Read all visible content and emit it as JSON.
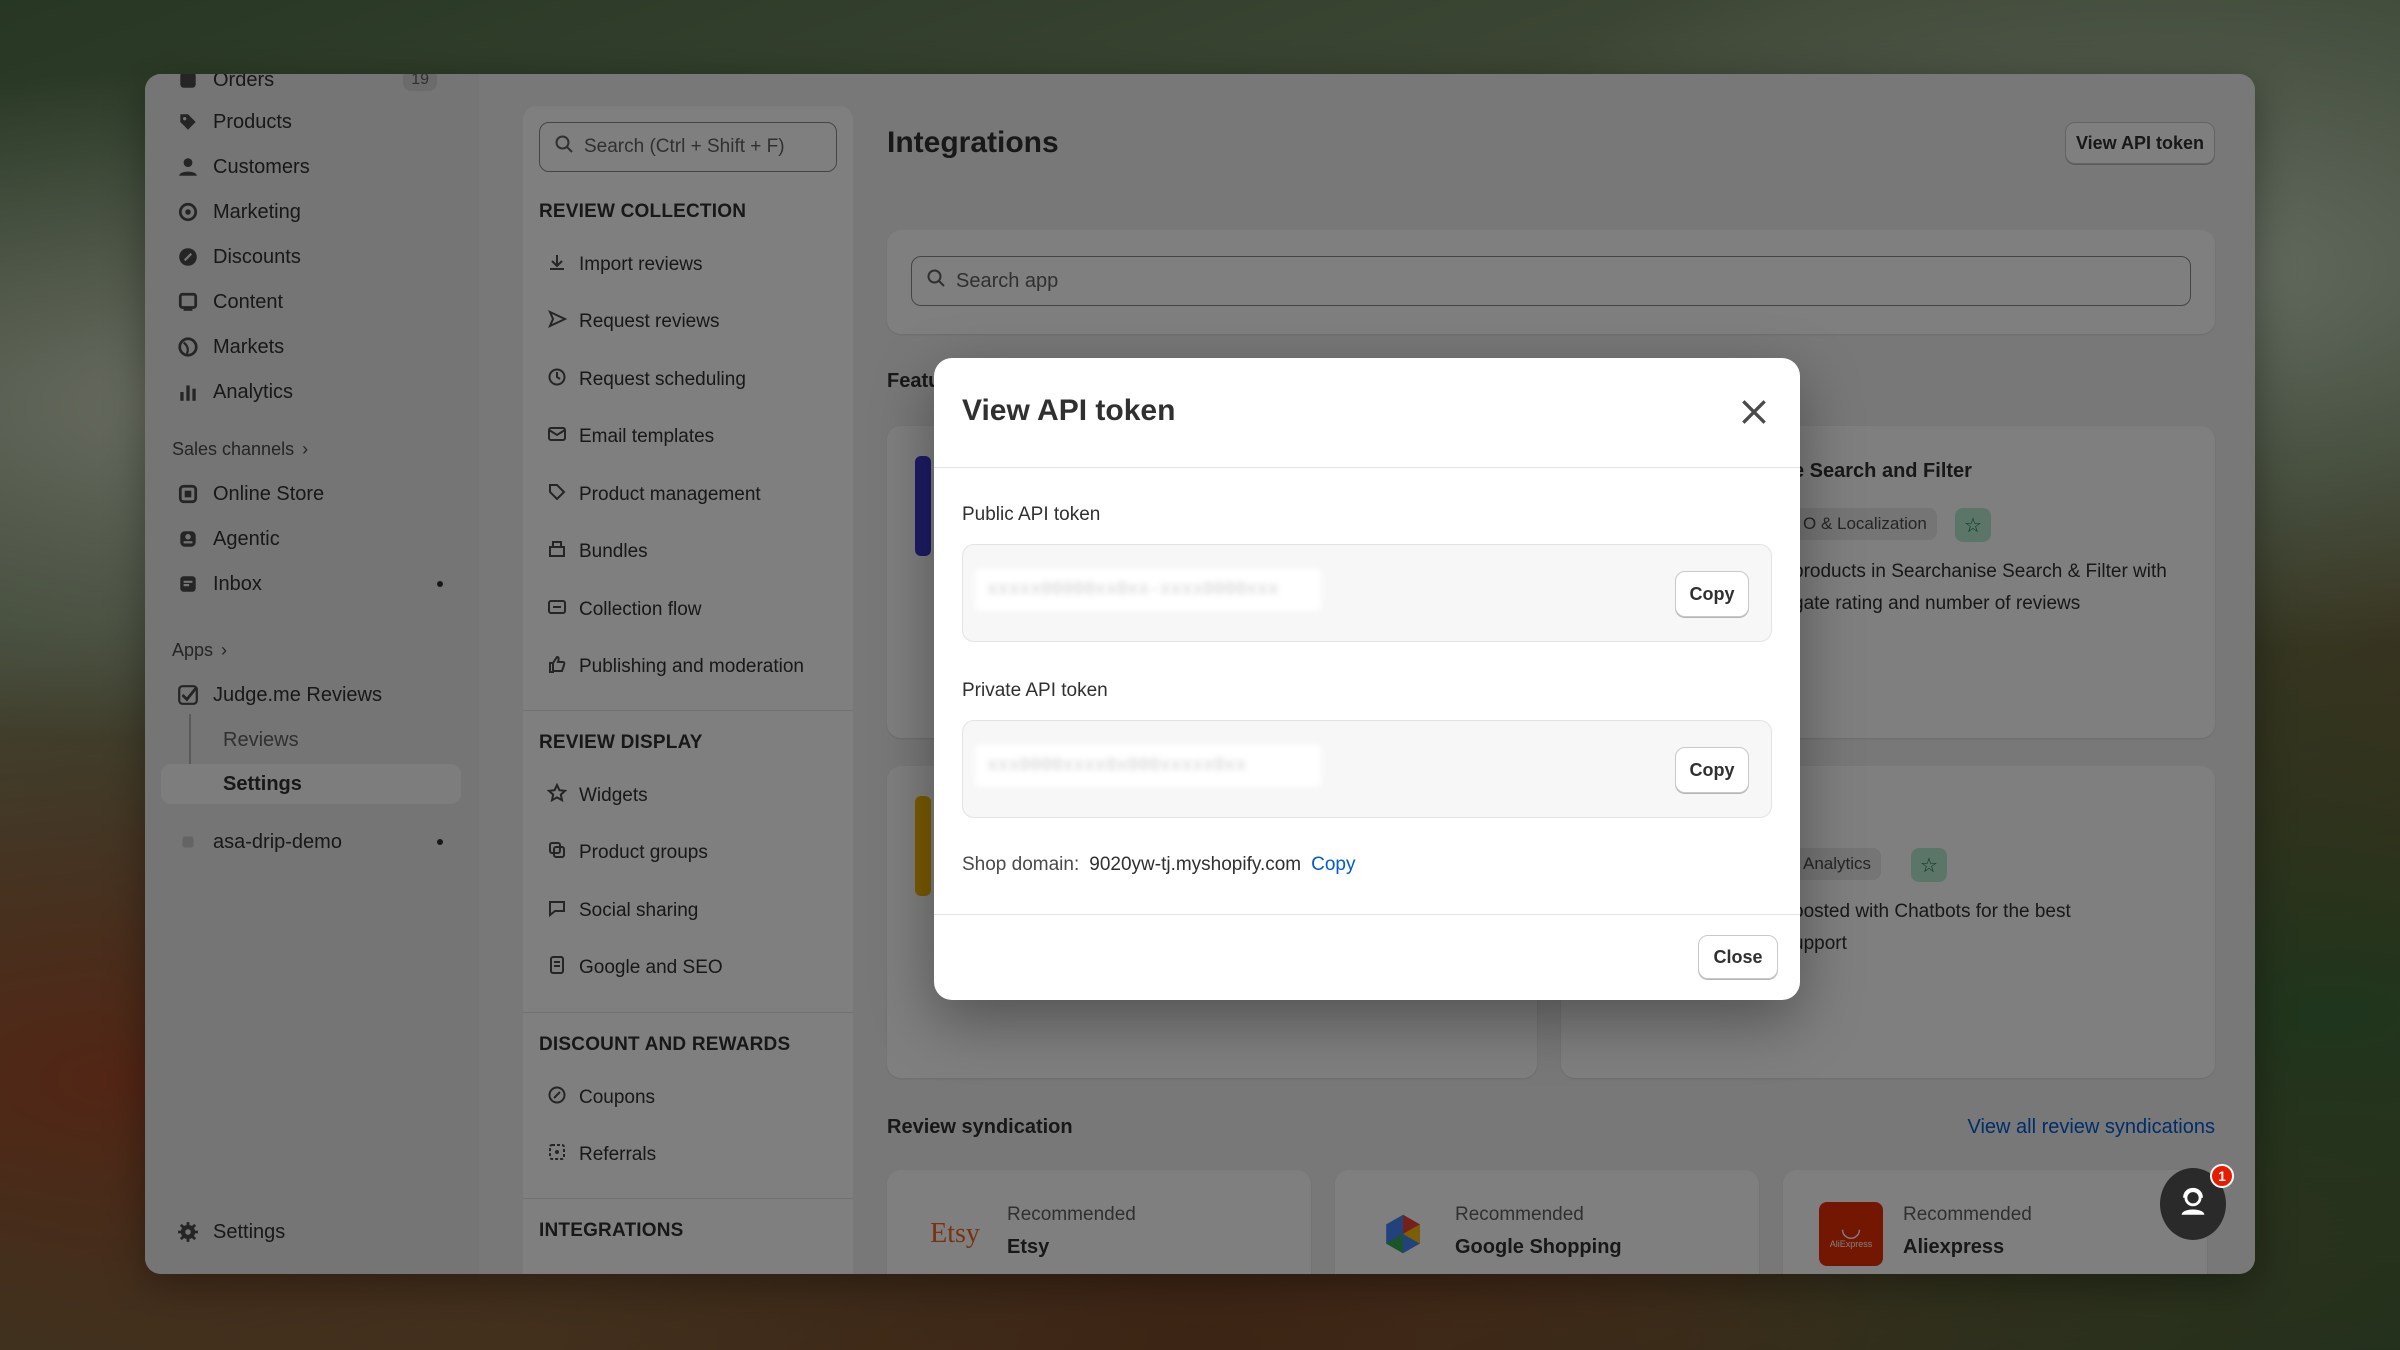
{
  "sidebar": {
    "orders": {
      "label": "Orders",
      "count": "19"
    },
    "items": [
      {
        "label": "Products"
      },
      {
        "label": "Customers"
      },
      {
        "label": "Marketing"
      },
      {
        "label": "Discounts"
      },
      {
        "label": "Content"
      },
      {
        "label": "Markets"
      },
      {
        "label": "Analytics"
      }
    ],
    "sales_channels_label": "Sales channels",
    "channels": [
      {
        "label": "Online Store"
      },
      {
        "label": "Agentic"
      },
      {
        "label": "Inbox"
      }
    ],
    "apps_label": "Apps",
    "app": {
      "label": "Judge.me Reviews"
    },
    "app_sub": [
      {
        "label": "Reviews"
      },
      {
        "label": "Settings"
      }
    ],
    "store": {
      "label": "asa-drip-demo"
    },
    "settings_label": "Settings"
  },
  "settings_nav": {
    "search_placeholder": "Search (Ctrl + Shift + F)",
    "sections": [
      {
        "title": "REVIEW COLLECTION",
        "items": [
          "Import reviews",
          "Request reviews",
          "Request scheduling",
          "Email templates",
          "Product management",
          "Bundles",
          "Collection flow",
          "Publishing and moderation"
        ]
      },
      {
        "title": "REVIEW DISPLAY",
        "items": [
          "Widgets",
          "Product groups",
          "Social sharing",
          "Google and SEO"
        ]
      },
      {
        "title": "DISCOUNT AND REWARDS",
        "items": [
          "Coupons",
          "Referrals"
        ]
      },
      {
        "title": "INTEGRATIONS",
        "items": []
      }
    ]
  },
  "content": {
    "title": "Integrations",
    "view_api_button": "View API token",
    "app_search_placeholder": "Search app",
    "featured_label_partial": "Featu",
    "card1": {
      "title_partial": "e Search and Filter",
      "tag_partial": "O & Localization",
      "desc_line1": "products in Searchanise Search & Filter with",
      "desc_line2": "gate rating and number of reviews"
    },
    "card2": {
      "tag_partial": "Analytics",
      "desc_line1": "oosted with Chatbots for the best",
      "desc_line2": "upport"
    },
    "syndication": {
      "title": "Review syndication",
      "view_all": "View all review syndications",
      "cards": [
        {
          "recommended": "Recommended",
          "name": "Etsy",
          "logo_text": "Etsy"
        },
        {
          "recommended": "Recommended",
          "name": "Google Shopping"
        },
        {
          "recommended": "Recommended",
          "name": "Aliexpress",
          "logo_text": "AliExpress"
        }
      ]
    }
  },
  "modal": {
    "title": "View API token",
    "public_label": "Public API token",
    "public_token": "xxxxx00000xx0xx-xxxx0000xxx",
    "private_label": "Private API token",
    "private_token": "xxx0000xxxx0x000xxxxx0xx",
    "copy_label": "Copy",
    "domain_label": "Shop domain:",
    "domain_value": "9020yw-tj.myshopify.com",
    "domain_copy": "Copy",
    "close_label": "Close"
  },
  "chat": {
    "badge": "1"
  },
  "colors": {
    "accent_link": "#005bd3",
    "badge_red": "#e51c00",
    "star_green": "#b6ecd0"
  }
}
